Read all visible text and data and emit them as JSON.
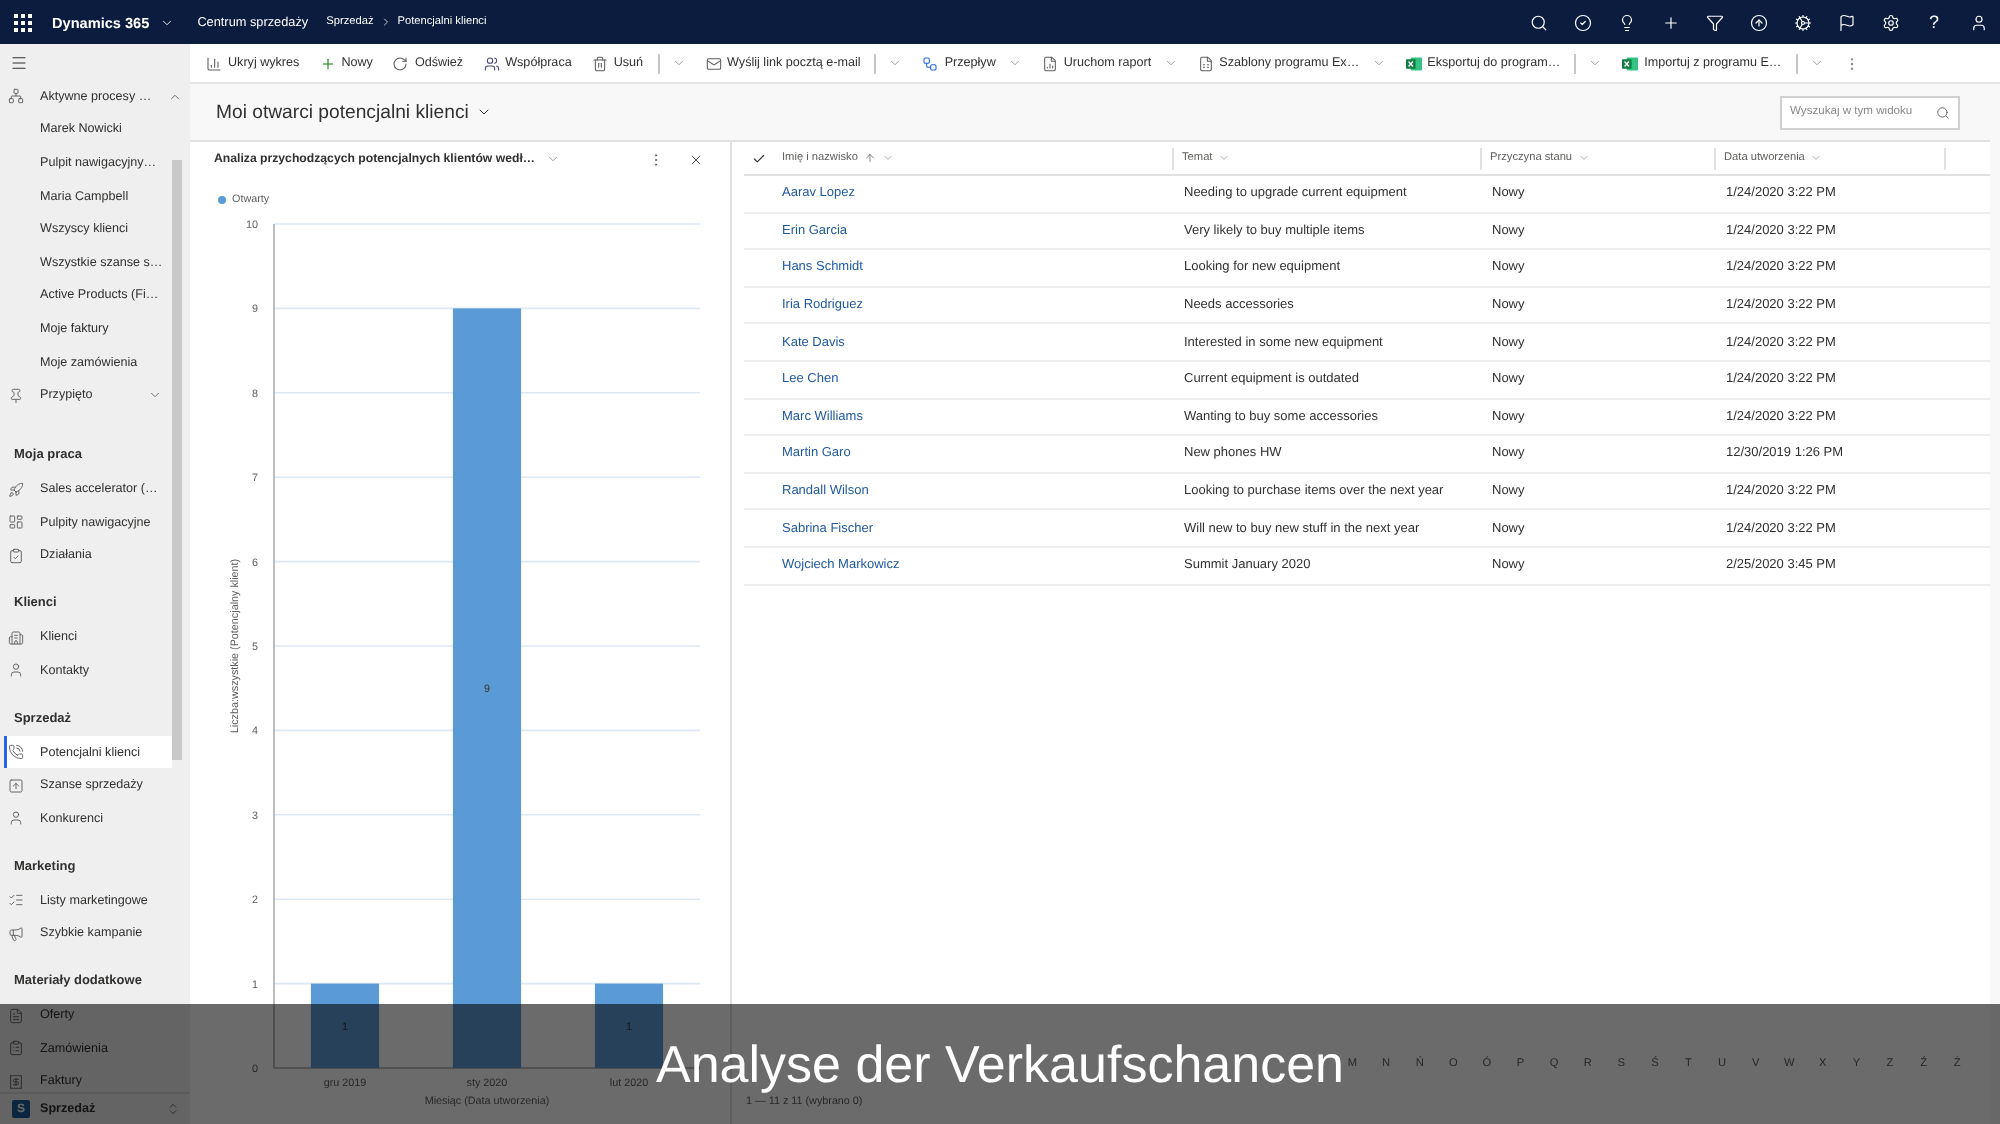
{
  "top_bar": {
    "app_name": "Dynamics 365",
    "app_area": "Centrum sprzedaży",
    "breadcrumb": [
      "Sprzedaż",
      "Potencjalni klienci"
    ],
    "help": "?"
  },
  "command_bar": {
    "commands": [
      {
        "label": "Ukryj wykres",
        "kind": "button"
      },
      {
        "label": "Nowy",
        "kind": "button"
      },
      {
        "label": "Odśwież",
        "kind": "button"
      },
      {
        "label": "Współpraca",
        "kind": "button"
      },
      {
        "label": "Usuń",
        "kind": "split"
      },
      {
        "label": "Wyślij link pocztą e-mail",
        "kind": "split"
      },
      {
        "label": "Przepływ",
        "kind": "menu"
      },
      {
        "label": "Uruchom raport",
        "kind": "menu"
      },
      {
        "label": "Szablony programu Ex…",
        "kind": "menu"
      },
      {
        "label": "Eksportuj do program…",
        "kind": "split"
      },
      {
        "label": "Importuj z programu E…",
        "kind": "split"
      }
    ]
  },
  "sidebar": {
    "recent": {
      "label": "Aktywne procesy …",
      "expanded": true,
      "children": [
        {
          "label": "Marek Nowicki",
          "selected": false
        },
        {
          "label": "Pulpit nawigacyjny…",
          "selected": false
        },
        {
          "label": "Maria Campbell",
          "selected": false
        },
        {
          "label": "Wszyscy klienci",
          "selected": false
        },
        {
          "label": "Wszystkie szanse s…",
          "selected": false
        },
        {
          "label": "Active Products (Fi…",
          "selected": false
        },
        {
          "label": "Moje faktury",
          "selected": false
        },
        {
          "label": "Moje zamówienia",
          "selected": false
        }
      ]
    },
    "pinned": {
      "label": "Przypięto",
      "expanded": false
    },
    "groups": [
      {
        "title": "Moja praca",
        "items": [
          {
            "label": "Sales accelerator (…",
            "selected": false
          },
          {
            "label": "Pulpity nawigacyjne",
            "selected": false
          },
          {
            "label": "Działania",
            "selected": false
          }
        ]
      },
      {
        "title": "Klienci",
        "items": [
          {
            "label": "Klienci",
            "selected": false
          },
          {
            "label": "Kontakty",
            "selected": false
          }
        ]
      },
      {
        "title": "Sprzedaż",
        "items": [
          {
            "label": "Potencjalni klienci",
            "selected": true
          },
          {
            "label": "Szanse sprzedaży",
            "selected": false
          },
          {
            "label": "Konkurenci",
            "selected": false
          }
        ]
      },
      {
        "title": "Marketing",
        "items": [
          {
            "label": "Listy marketingowe",
            "selected": false
          },
          {
            "label": "Szybkie kampanie",
            "selected": false
          }
        ]
      },
      {
        "title": "Materiały dodatkowe",
        "items": [
          {
            "label": "Oferty",
            "selected": false
          },
          {
            "label": "Zamówienia",
            "selected": false
          },
          {
            "label": "Faktury",
            "selected": false
          }
        ]
      }
    ],
    "area": {
      "initial": "S",
      "label": "Sprzedaż"
    }
  },
  "view": {
    "title": "Moi otwarci potencjalni klienci",
    "search": {
      "placeholder": "Wyszukaj w tym widoku"
    }
  },
  "chart_panel": {
    "chart_data": {
      "type": "bar",
      "title": "Analiza przychodzących potencjalnych klientów wedł…",
      "xlabel": "Miesiąc (Data utworzenia)",
      "ylabel": "Liczba:wszystkie (Potencjalny klient)",
      "categories": [
        "gru 2019",
        "sty 2020",
        "lut 2020"
      ],
      "series": [
        {
          "name": "Otwarty",
          "color": "#5b9bd5",
          "values": [
            1,
            9,
            1
          ]
        }
      ],
      "ylim": [
        0,
        10
      ],
      "yticks": [
        0,
        1,
        2,
        3,
        4,
        5,
        6,
        7,
        8,
        9,
        10
      ],
      "grid": true,
      "data_labels": true
    }
  },
  "grid": {
    "columns": [
      {
        "label": "Imię i nazwisko",
        "sorted": true
      },
      {
        "label": "Temat",
        "sorted": false
      },
      {
        "label": "Przyczyna stanu",
        "sorted": false
      },
      {
        "label": "Data utworzenia",
        "sorted": false
      }
    ],
    "rows": [
      {
        "selected": false,
        "cells": [
          "Aarav Lopez",
          "Needing to upgrade current equipment",
          "Nowy",
          "1/24/2020 3:22 PM"
        ]
      },
      {
        "selected": false,
        "cells": [
          "Erin Garcia",
          "Very likely to buy multiple items",
          "Nowy",
          "1/24/2020 3:22 PM"
        ]
      },
      {
        "selected": false,
        "cells": [
          "Hans Schmidt",
          "Looking for new equipment",
          "Nowy",
          "1/24/2020 3:22 PM"
        ]
      },
      {
        "selected": false,
        "cells": [
          "Iria Rodriguez",
          "Needs accessories",
          "Nowy",
          "1/24/2020 3:22 PM"
        ]
      },
      {
        "selected": false,
        "cells": [
          "Kate Davis",
          "Interested in some new equipment",
          "Nowy",
          "1/24/2020 3:22 PM"
        ]
      },
      {
        "selected": false,
        "cells": [
          "Lee Chen",
          "Current equipment is outdated",
          "Nowy",
          "1/24/2020 3:22 PM"
        ]
      },
      {
        "selected": false,
        "cells": [
          "Marc Williams",
          "Wanting to buy some accessories",
          "Nowy",
          "1/24/2020 3:22 PM"
        ]
      },
      {
        "selected": false,
        "cells": [
          "Martin Garo",
          "New phones HW",
          "Nowy",
          "12/30/2019 1:26 PM"
        ]
      },
      {
        "selected": false,
        "cells": [
          "Randall Wilson",
          "Looking to purchase items over the next year",
          "Nowy",
          "1/24/2020 3:22 PM"
        ]
      },
      {
        "selected": false,
        "cells": [
          "Sabrina Fischer",
          "Will new to buy new stuff in the next year",
          "Nowy",
          "1/24/2020 3:22 PM"
        ]
      },
      {
        "selected": false,
        "cells": [
          "Wojciech Markowicz",
          "Summit January 2020",
          "Nowy",
          "2/25/2020 3:45 PM"
        ]
      }
    ]
  },
  "jump_bar": {
    "letters": [
      "M",
      "N",
      "Ń",
      "O",
      "Ó",
      "P",
      "Q",
      "R",
      "S",
      "Ś",
      "T",
      "U",
      "V",
      "W",
      "X",
      "Y",
      "Z",
      "Ź",
      "Ż"
    ]
  },
  "footer": "1 — 11 z 11 (wybrano 0)",
  "caption": "Analyse der Verkaufschancen"
}
